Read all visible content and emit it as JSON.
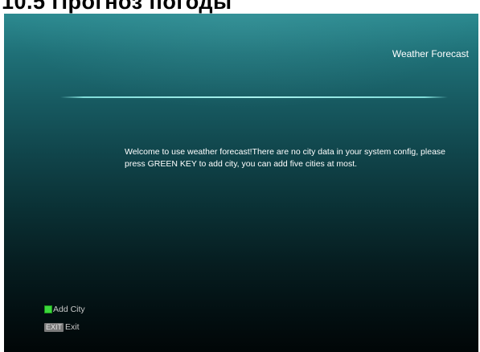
{
  "page_caption": "10.5 Прогноз погоды",
  "window": {
    "title": "Weather Forecast"
  },
  "message": {
    "text": "Welcome to use weather forecast!There are no city data in your system config, please press GREEN KEY to add city, you can add five cities at most."
  },
  "hints": [
    {
      "key_icon": "green-key-icon",
      "key_color": "#3bd83b",
      "key_label": "",
      "label": "Add City"
    },
    {
      "key_icon": "exit-key-icon",
      "key_color": "#7a7a7a",
      "key_label": "EXIT",
      "label": "Exit"
    }
  ],
  "colors": {
    "panel_top": "#2c8a90",
    "panel_bottom": "#010607",
    "divider": "#a9f2ee",
    "text": "#ffffff",
    "hint_text": "#c9c9c9"
  }
}
